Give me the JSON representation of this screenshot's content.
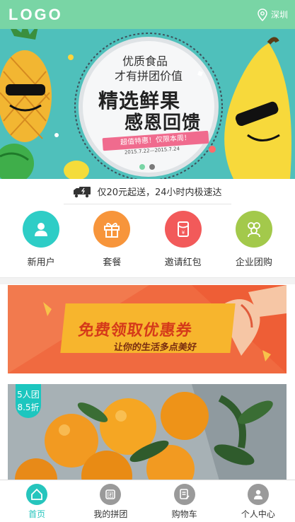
{
  "header": {
    "logo": "LOGO",
    "city": "深圳"
  },
  "banner": {
    "line1": "优质食品",
    "line2": "才有拼团价值",
    "line3": "精选鲜果",
    "line4": "感恩回馈",
    "ribbon": "超值特惠！仅限本周！",
    "date": "2015.7.22—2015.7.24",
    "slide_count": 2,
    "active_slide": 1
  },
  "delivery": {
    "text": "仅20元起送，24小时内极速达"
  },
  "quick_menu": [
    {
      "label": "新用户",
      "color": "#2ecdc6",
      "icon": "user-icon"
    },
    {
      "label": "套餐",
      "color": "#f7953b",
      "icon": "gift-icon"
    },
    {
      "label": "邀请红包",
      "color": "#f25a5a",
      "icon": "red-envelope-icon"
    },
    {
      "label": "企业团购",
      "color": "#a3c94b",
      "icon": "group-icon"
    }
  ],
  "coupon": {
    "title": "免费领取优惠券",
    "subtitle": "让你的生活多点美好"
  },
  "product": {
    "badge_line1": "5人团",
    "badge_line2": "8.5折"
  },
  "tabbar": [
    {
      "label": "首页",
      "icon": "home-icon",
      "active": true
    },
    {
      "label": "我的拼团",
      "icon": "group-buy-icon",
      "active": false
    },
    {
      "label": "购物车",
      "icon": "cart-icon",
      "active": false
    },
    {
      "label": "个人中心",
      "icon": "profile-icon",
      "active": false
    }
  ],
  "colors": {
    "header": "#79d5a5",
    "accent": "#26c5bd"
  }
}
